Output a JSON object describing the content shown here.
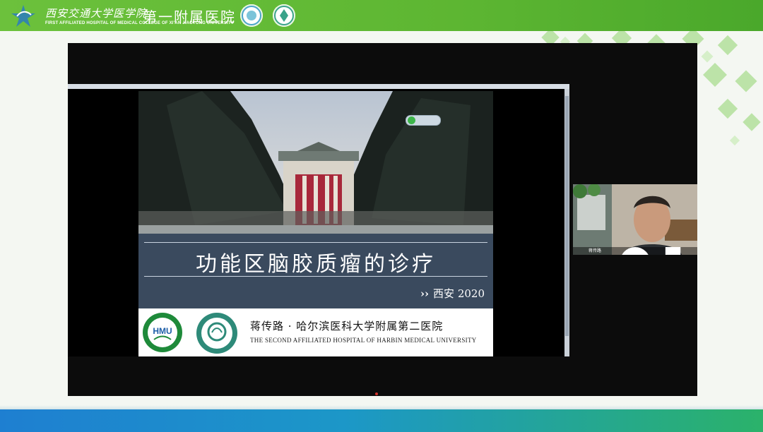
{
  "header": {
    "brand_cn": "西安交通大学医学院",
    "brand_en": "FIRST AFFILIATED HOSPITAL OF MEDICAL COLLEGE OF XI'AN JIAOTONG UNIVERSITY",
    "hospital_name": "第一附属医院"
  },
  "slide": {
    "title": "功能区脑胶质瘤的诊疗",
    "subtitle_arrows": "››",
    "subtitle": "西安 2020",
    "author_cn": "蒋传路 · 哈尔滨医科大学附属第二医院",
    "author_en": "THE SECOND AFFILIATED HOSPITAL OF HARBIN MEDICAL UNIVERSITY",
    "hmu_logo_text": "HMU"
  },
  "video": {
    "participant_name": "蒋传路"
  },
  "colors": {
    "header_green": "#5db632",
    "slide_band": "#3a4a5e",
    "bottom_blue": "#1e7fd1"
  }
}
